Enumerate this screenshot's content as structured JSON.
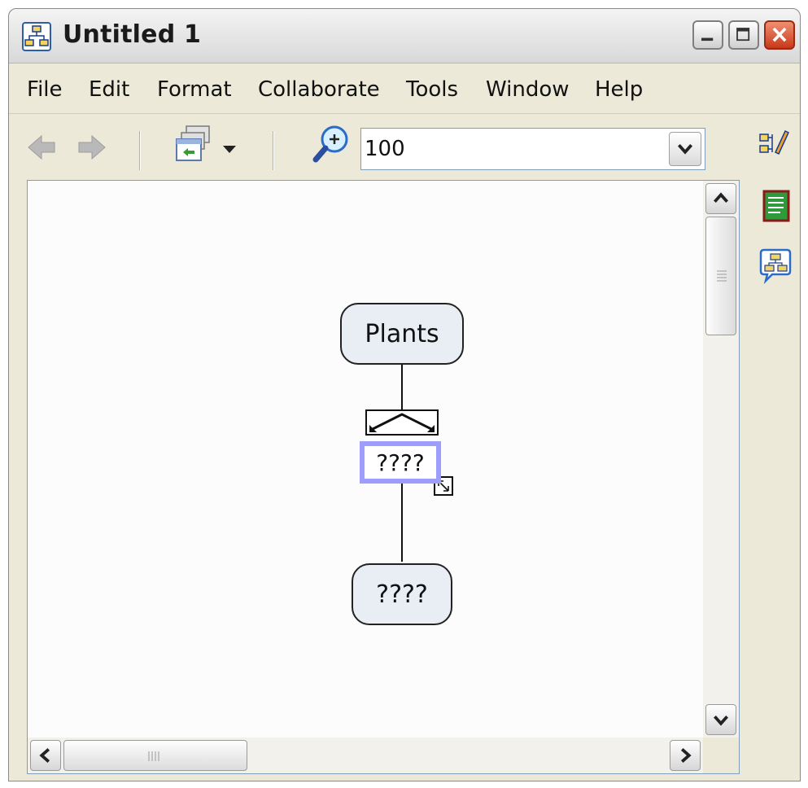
{
  "window": {
    "title": "Untitled 1",
    "app_icon": "concept-map-icon",
    "controls": [
      "minimize-icon",
      "maximize-icon",
      "close-icon"
    ]
  },
  "menu": {
    "items": [
      "File",
      "Edit",
      "Format",
      "Collaborate",
      "Tools",
      "Window",
      "Help"
    ]
  },
  "toolbar": {
    "icons": [
      "back-arrow-icon",
      "forward-arrow-icon",
      "view-switcher-icon",
      "dropdown-arrow-icon",
      "zoom-icon"
    ],
    "zoom_value": "100"
  },
  "side_panel": {
    "icons": [
      "style-palette-icon",
      "notes-icon",
      "cmap-discussion-icon"
    ]
  },
  "map": {
    "top_concept": "Plants",
    "linking_phrase": "????",
    "bottom_concept": "????"
  },
  "colors": {
    "link_selection": "#9d9dfd",
    "concept_fill": "#e8eef3",
    "close_button": "#c8381a"
  }
}
